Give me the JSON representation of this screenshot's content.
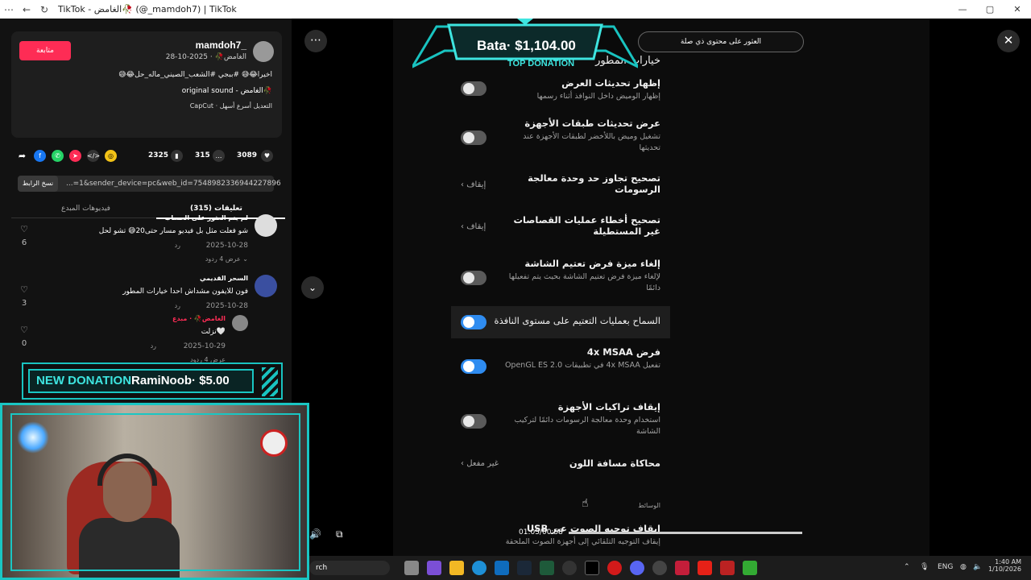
{
  "window": {
    "title": "TikTok - الغامض🥀 (@_mamdoh7) | TikTok",
    "min": "—",
    "max": "▢",
    "close": "✕",
    "back": "←",
    "reload": "↻",
    "menu": "⋯"
  },
  "post": {
    "follow_label": "متابعة",
    "username": "mamdoh7_",
    "display_date": "الغامض🥀 · 2025-10-28",
    "caption": "اخيرا😂😅 #ببجي #الشعب_الصيني_ماله_حل😂😅",
    "sound": "original sound - الغامض🥀",
    "capcut": "CapCut · التعديل أسرع أسهل",
    "likes": "3089",
    "comments": "315",
    "saves": "2325",
    "copy_link_label": "نسخ الرابط",
    "link_text": "...=1&sender_device=pc&web_id=7548982336944227896",
    "tab_comments": "تعليقات (315)",
    "tab_creator": "فيديوهات المبدع"
  },
  "comments": [
    {
      "name": "لم يتم العثور على الحساب",
      "text": "شو فعلت مثل بل فيديو مسار حتى20😅 تشو لحل",
      "date": "2025-10-28",
      "reply": "رد",
      "more": "عرض 4 ردود ⌄",
      "likes": "6"
    },
    {
      "name": "السحر القديمي",
      "text": "فون للايفون مشداش احدا خيارات المطور",
      "date": "2025-10-28",
      "reply": "رد",
      "more": "",
      "likes": "3"
    },
    {
      "name": "الغامض🥀 · مبدع",
      "text": "نزلت🤍",
      "date": "2025-10-29",
      "reply": "رد",
      "more": "عرض 4 ردود",
      "likes": "0"
    }
  ],
  "donation": {
    "title": "NEW DONATION",
    "text": "RamiNoob· $5.00"
  },
  "top_donation": {
    "amount": "Bata· $1,104.00",
    "label": "TOP DONATION"
  },
  "tooltip": "العثور على محتوى ذي صلة",
  "settings": {
    "header": "خيارات المطور",
    "rows": [
      {
        "title": "إظهار تحديثات العرض",
        "sub": "إظهار الوميض داخل النوافذ أثناء رسمها",
        "control": "toggle-off"
      },
      {
        "title": "عرض تحديثات طبقات الأجهزة",
        "sub": "تشغيل وميض باللأخضر لطبقات الأجهزة عند تحديثها",
        "control": "toggle-off"
      },
      {
        "title": "تصحيح تجاوز حد وحدة معالجة الرسومات",
        "sub": "",
        "control": "value",
        "value": "إيقاف"
      },
      {
        "title": "تصحيح أخطاء عمليات القصاصات غير المستطيلة",
        "sub": "",
        "control": "value",
        "value": "إيقاف"
      },
      {
        "title": "إلغاء ميزة فرض تعتيم الشاشة",
        "sub": "لإلغاء ميزة فرض تعتيم الشاشة بحيث يتم تفعيلها دائمًا",
        "control": "toggle-off"
      },
      {
        "title": "السماح بعمليات التعتيم على مستوى النافذة",
        "sub": "",
        "control": "toggle-on"
      },
      {
        "title": "فرض 4x MSAA",
        "sub": "تفعيل 4x MSAA في تطبيقات OpenGL ES 2.0",
        "control": "toggle-on"
      },
      {
        "title": "إيقاف تراكبات الأجهزة",
        "sub": "استخدام وحدة معالجة الرسومات دائمًا لتركيب الشاشة",
        "control": "toggle-off"
      },
      {
        "title": "محاكاة مسافة اللون",
        "sub": "",
        "control": "value",
        "value": "غير مفعل"
      }
    ],
    "section_media": "الوسائط",
    "usb_title": "إيقاف توجيه الصوت عبر USB",
    "usb_sub": "إيقاف التوجيه التلقائي إلى أجهزة الصوت الملحقة"
  },
  "player": {
    "time": "01:05/00:58",
    "progress": 0.0
  },
  "taskbar": {
    "search": "rch",
    "lang": "ENG",
    "time": "1:40 AM",
    "date": "1/10/2026"
  },
  "colors": {
    "accent": "#fe2c55",
    "donation": "#1ac6c3",
    "toggle_on": "#2f8cf0"
  }
}
